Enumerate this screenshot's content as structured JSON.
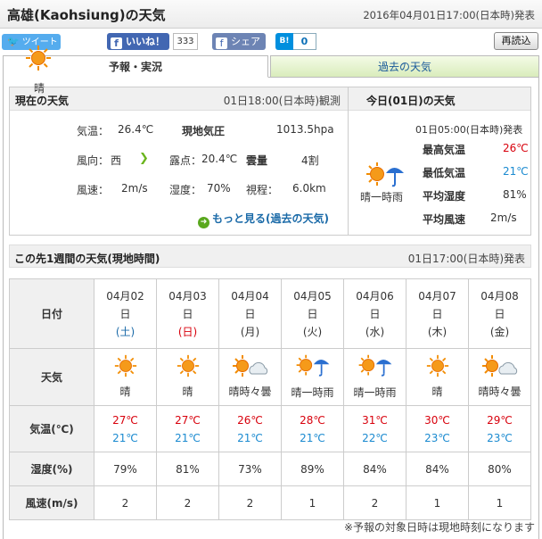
{
  "header": {
    "title": "高雄(Kaohsiung)の天気",
    "issued": "2016年04月01日17:00(日本時)発表"
  },
  "social": {
    "tweet": "ツイート",
    "like": "いいね！",
    "like_count": "333",
    "share": "シェア",
    "hatena": "B!",
    "hatena_count": "0"
  },
  "reload": "再読込",
  "tabs": [
    {
      "label": "予報・実況"
    },
    {
      "label": "過去の天気"
    }
  ],
  "current": {
    "title": "現在の天気",
    "observed": "01日18:00(日本時)観測",
    "icon": "sun-icon",
    "weather": "晴",
    "temp_label": "気温：",
    "temp": "26.4℃",
    "pressure_label": "現地気圧",
    "pressure": "1013.5hpa",
    "wind_dir_label": "風向：",
    "wind_dir": "西",
    "dew_label": "露点：",
    "dew": "20.4℃",
    "cloud_label": "雲量",
    "cloud": "4割",
    "wind_speed_label": "風速：",
    "wind_speed": "2m/s",
    "humidity_label": "湿度：",
    "humidity": "70%",
    "visibility_label": "視程：",
    "visibility": "6.0km",
    "more": "もっと見る(過去の天気)"
  },
  "today": {
    "title": "今日(01日)の天気",
    "issued": "01日05:00(日本時)発表",
    "icon": "sun-rain-icon",
    "weather": "晴一時雨",
    "max_label": "最高気温",
    "max": "26℃",
    "min_label": "最低気温",
    "min": "21℃",
    "hum_label": "平均湿度",
    "hum": "81%",
    "wind_label": "平均風速",
    "wind": "2m/s"
  },
  "week": {
    "title": "この先1週間の天気(現地時間)",
    "issued": "01日17:00(日本時)発表",
    "row_labels": {
      "date": "日付",
      "weather": "天気",
      "temp": "気温(℃)",
      "humidity": "湿度(%)",
      "wind": "風速(m/s)"
    },
    "days": [
      {
        "date": "04月02",
        "d": "日",
        "wd": "(土)",
        "wdtype": "sat",
        "icon": "sun",
        "weather": "晴",
        "hi": "27℃",
        "lo": "21℃",
        "hum": "79%",
        "wind": "2"
      },
      {
        "date": "04月03",
        "d": "日",
        "wd": "(日)",
        "wdtype": "sun",
        "icon": "sun",
        "weather": "晴",
        "hi": "27℃",
        "lo": "21℃",
        "hum": "81%",
        "wind": "2"
      },
      {
        "date": "04月04",
        "d": "日",
        "wd": "(月)",
        "wdtype": "",
        "icon": "sun-cloud",
        "weather": "晴時々曇",
        "hi": "26℃",
        "lo": "21℃",
        "hum": "73%",
        "wind": "2"
      },
      {
        "date": "04月05",
        "d": "日",
        "wd": "(火)",
        "wdtype": "",
        "icon": "sun-rain",
        "weather": "晴一時雨",
        "hi": "28℃",
        "lo": "21℃",
        "hum": "89%",
        "wind": "1"
      },
      {
        "date": "04月06",
        "d": "日",
        "wd": "(水)",
        "wdtype": "",
        "icon": "sun-rain",
        "weather": "晴一時雨",
        "hi": "31℃",
        "lo": "22℃",
        "hum": "84%",
        "wind": "2"
      },
      {
        "date": "04月07",
        "d": "日",
        "wd": "(木)",
        "wdtype": "",
        "icon": "sun",
        "weather": "晴",
        "hi": "30℃",
        "lo": "23℃",
        "hum": "84%",
        "wind": "1"
      },
      {
        "date": "04月08",
        "d": "日",
        "wd": "(金)",
        "wdtype": "",
        "icon": "sun-cloud",
        "weather": "晴時々曇",
        "hi": "29℃",
        "lo": "23℃",
        "hum": "80%",
        "wind": "1"
      }
    ]
  },
  "note": "※予報の対象日時は現地時刻になります"
}
